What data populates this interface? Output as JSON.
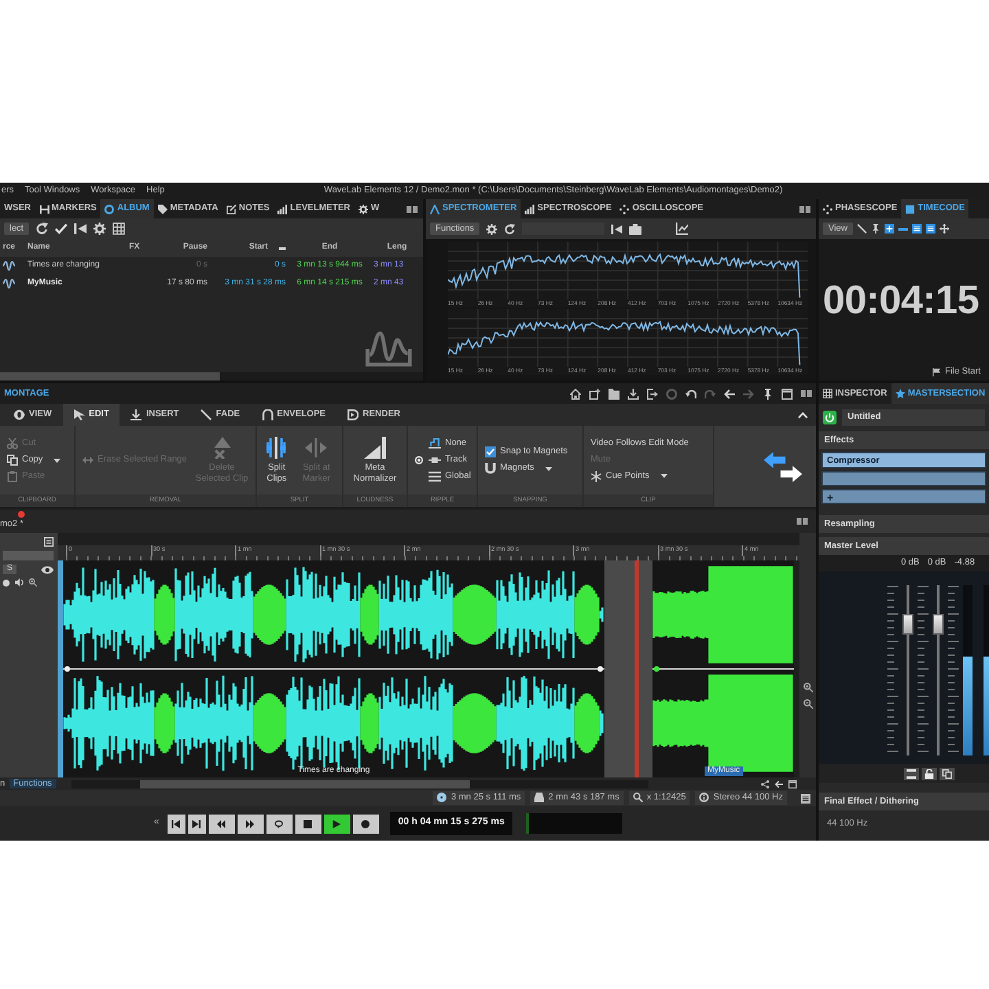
{
  "menu_bar": {
    "items": [
      "ers",
      "Tool Windows",
      "Workspace",
      "Help"
    ],
    "title": "WaveLab Elements 12 / Demo2.mon * (C:\\Users\\Documents\\Steinberg\\WaveLab Elements\\Audiomontages\\Demo2)"
  },
  "left_panel": {
    "tabs": [
      {
        "label": "WSER",
        "selected": false
      },
      {
        "label": "MARKERS",
        "selected": false
      },
      {
        "label": "ALBUM",
        "selected": true
      },
      {
        "label": "METADATA",
        "selected": false
      },
      {
        "label": "NOTES",
        "selected": false
      },
      {
        "label": "LEVELMETER",
        "selected": false
      },
      {
        "label": "W",
        "selected": false
      }
    ],
    "select_button": "lect",
    "columns": [
      "rce",
      "Name",
      "FX",
      "Pause",
      "Start",
      "End",
      "Leng"
    ],
    "rows": [
      {
        "name": "Times are changing",
        "pause": "0 s",
        "pause_dimmed": true,
        "start": "0 s",
        "end": "3 mn 13 s 944 ms",
        "length": "3 mn 13",
        "current": false
      },
      {
        "name": "MyMusic",
        "pause": "17 s 80 ms",
        "pause_dimmed": false,
        "start": "3 mn 31 s 28 ms",
        "end": "6 mn 14 s 215 ms",
        "length": "2 mn 43",
        "current": true
      }
    ]
  },
  "analysis_panel": {
    "tabs": [
      {
        "label": "SPECTROMETER",
        "selected": true
      },
      {
        "label": "SPECTROSCOPE",
        "selected": false
      },
      {
        "label": "OSCILLOSCOPE",
        "selected": false
      }
    ],
    "functions_button": "Functions",
    "graphs": [
      {
        "freq_labels": [
          "15 Hz",
          "26 Hz",
          "40 Hz",
          "73 Hz",
          "124 Hz",
          "208 Hz",
          "412 Hz",
          "703 Hz",
          "1075 Hz",
          "2720 Hz",
          "5378 Hz",
          "10634 Hz"
        ]
      },
      {
        "freq_labels": [
          "15 Hz",
          "26 Hz",
          "40 Hz",
          "73 Hz",
          "124 Hz",
          "208 Hz",
          "412 Hz",
          "703 Hz",
          "1075 Hz",
          "2720 Hz",
          "5378 Hz",
          "10634 Hz"
        ]
      }
    ]
  },
  "time_panel": {
    "tabs": [
      {
        "label": "PHASESCOPE",
        "selected": false
      },
      {
        "label": "TIMECODE",
        "selected": true
      }
    ],
    "view_button": "View",
    "time": "00:04:15",
    "file_start": "File Start"
  },
  "montage": {
    "title": "MONTAGE",
    "ribbon_tabs": [
      {
        "label": "VIEW",
        "selected": false
      },
      {
        "label": "EDIT",
        "selected": true
      },
      {
        "label": "INSERT",
        "selected": false
      },
      {
        "label": "FADE",
        "selected": false
      },
      {
        "label": "ENVELOPE",
        "selected": false
      },
      {
        "label": "RENDER",
        "selected": false
      }
    ],
    "groups": [
      {
        "label": "CLIPBOARD",
        "items": [
          {
            "kind": "small",
            "label": "Cut",
            "disabled": true,
            "dropdown": false
          },
          {
            "kind": "small",
            "label": "Copy",
            "disabled": false,
            "dropdown": true
          },
          {
            "kind": "small",
            "label": "Paste",
            "disabled": true,
            "dropdown": false
          }
        ]
      },
      {
        "label": "REMOVAL",
        "items": [
          {
            "kind": "small",
            "label": "Erase Selected Range",
            "disabled": true,
            "dropdown": false
          },
          {
            "kind": "large",
            "label": "Delete Selected Clip",
            "disabled": true
          }
        ]
      },
      {
        "label": "SPLIT",
        "items": [
          {
            "kind": "large",
            "label": "Split Clips",
            "disabled": false
          },
          {
            "kind": "large",
            "label": "Split at Marker",
            "disabled": true
          }
        ]
      },
      {
        "label": "LOUDNESS",
        "items": [
          {
            "kind": "large",
            "label": "Meta Normalizer",
            "disabled": false
          }
        ]
      },
      {
        "label": "RIPPLE",
        "items": [
          {
            "kind": "radio",
            "label": "None",
            "selected": false
          },
          {
            "kind": "radio",
            "label": "Track",
            "selected": true
          },
          {
            "kind": "radio",
            "label": "Global",
            "selected": false
          }
        ]
      },
      {
        "label": "SNAPPING",
        "items": [
          {
            "kind": "check",
            "label": "Snap to Magnets",
            "checked": true
          },
          {
            "kind": "small",
            "label": "Magnets",
            "disabled": false,
            "dropdown": true
          }
        ]
      },
      {
        "label": "CLIP",
        "items": [
          {
            "kind": "small",
            "label": "Video Follows Edit Mode",
            "disabled": false,
            "dropdown": false
          },
          {
            "kind": "small",
            "label": "Mute",
            "disabled": true,
            "dropdown": false
          },
          {
            "kind": "small",
            "label": "Cue Points",
            "disabled": false,
            "dropdown": true
          }
        ]
      }
    ],
    "document_tab": {
      "label": "mo2 *",
      "modified": true
    },
    "track": {
      "solo_button": "S",
      "ruler": [
        "0",
        "30 s",
        "1 mn",
        "1 mn 30 s",
        "2 mn",
        "2 mn 30 s",
        "3 mn",
        "3 mn 30 s",
        "4 mn"
      ],
      "clips": [
        {
          "label": "Times are changing",
          "selected": false
        },
        {
          "label": "MyMusic",
          "selected": true
        }
      ]
    },
    "scroll_row": {
      "label": "n",
      "button": "Functions"
    },
    "status": [
      "3 mn 25 s 111 ms",
      "2 mn 43 s 187 ms",
      "x 1:12425",
      "Stereo 44 100 Hz"
    ],
    "transport": {
      "collapse": "«",
      "buttons": [
        {
          "kind": "to_start",
          "active": false
        },
        {
          "kind": "to_end",
          "active": false
        },
        {
          "kind": "rewind",
          "active": false
        },
        {
          "kind": "forward",
          "active": false
        },
        {
          "kind": "loop",
          "active": false
        },
        {
          "kind": "stop",
          "active": false
        },
        {
          "kind": "play",
          "active": true
        },
        {
          "kind": "record",
          "active": false
        }
      ],
      "time": "00 h 04 mn 15 s 275 ms"
    }
  },
  "inspector": {
    "tabs": [
      {
        "label": "INSPECTOR",
        "selected": false
      },
      {
        "label": "MASTERSECTION",
        "selected": true
      }
    ],
    "preset": {
      "name": "Untitled",
      "on": true
    },
    "effects": {
      "title": "Effects",
      "slots": [
        {
          "label": "Compressor",
          "selected": true
        },
        {
          "selected": false
        }
      ],
      "add_button": "+"
    },
    "resampling": "Resampling",
    "master_level": {
      "title": "Master Level",
      "readings": [
        "0 dB",
        "0 dB",
        "-4.88"
      ],
      "faders": [
        {
          "level": 0.77
        },
        {
          "level": 0.77
        }
      ],
      "meters": [
        {
          "level": 0.58
        },
        {
          "level": 0.58
        }
      ]
    },
    "final_effect": {
      "title": "Final Effect / Dithering",
      "value": "44 100 Hz"
    }
  }
}
